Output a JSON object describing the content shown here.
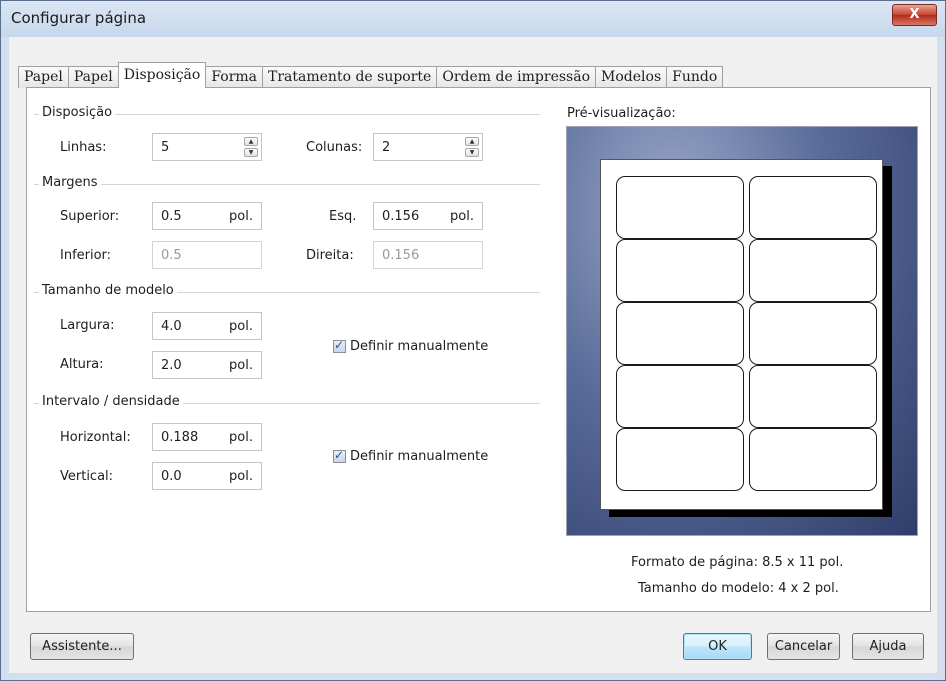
{
  "window": {
    "title": "Configurar página",
    "close_label": "X"
  },
  "tabs": [
    {
      "label": "Papel",
      "active": false
    },
    {
      "label": "Papel",
      "active": false
    },
    {
      "label": "Disposição",
      "active": true
    },
    {
      "label": "Forma",
      "active": false
    },
    {
      "label": "Tratamento de suporte",
      "active": false
    },
    {
      "label": "Ordem de impressão",
      "active": false
    },
    {
      "label": "Modelos",
      "active": false
    },
    {
      "label": "Fundo",
      "active": false
    }
  ],
  "layout_group": {
    "label": "Disposição",
    "rows_label": "Linhas:",
    "rows_value": "5",
    "cols_label": "Colunas:",
    "cols_value": "2"
  },
  "margins_group": {
    "label": "Margens",
    "top_label": "Superior:",
    "top_value": "0.5",
    "top_unit": "pol.",
    "left_label": "Esq.",
    "left_value": "0.156",
    "left_unit": "pol.",
    "bottom_label": "Inferior:",
    "bottom_value": "0.5",
    "right_label": "Direita:",
    "right_value": "0.156"
  },
  "label_size_group": {
    "label": "Tamanho de modelo",
    "width_label": "Largura:",
    "width_value": "4.0",
    "width_unit": "pol.",
    "height_label": "Altura:",
    "height_value": "2.0",
    "height_unit": "pol.",
    "manual_label": "Definir manualmente",
    "manual_checked": true
  },
  "gap_group": {
    "label": "Intervalo / densidade",
    "horizontal_label": "Horizontal:",
    "horizontal_value": "0.188",
    "horizontal_unit": "pol.",
    "vertical_label": "Vertical:",
    "vertical_value": "0.0",
    "vertical_unit": "pol.",
    "manual_label": "Definir manualmente",
    "manual_checked": true
  },
  "preview": {
    "label": "Pré-visualização:",
    "rows": 5,
    "columns": 2,
    "page_format_label": "Formato de página:",
    "page_format_value": "8.5 x 11 pol.",
    "label_size_label": "Tamanho do modelo:",
    "label_size_value": "4 x 2 pol."
  },
  "buttons": {
    "wizard": "Assistente...",
    "ok": "OK",
    "cancel": "Cancelar",
    "help": "Ajuda"
  },
  "colors": {
    "titlebar": "#c7d7ec",
    "preview_bg": "#5a6c9a",
    "close_button": "#c7412f"
  }
}
